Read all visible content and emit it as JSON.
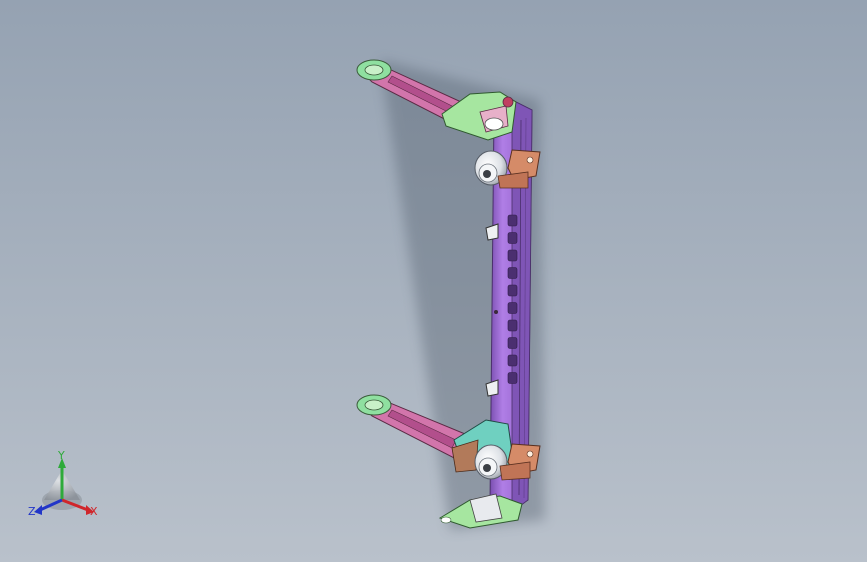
{
  "viewport": {
    "background_top": "#95a2b2",
    "background_bottom": "#b9c1cb"
  },
  "model": {
    "description_icon": "front-subframe-assembly",
    "colors": {
      "crossmember": "#a56fdb",
      "arm": "#cf6fa6",
      "bracket_green": "#a6e6a0",
      "bushing": "#e9ecef",
      "mount_orange": "#d58b68",
      "dark_edge": "#3a2a3a"
    }
  },
  "triad": {
    "x_label": "X",
    "y_label": "Y",
    "z_label": "Z",
    "x_color": "#d0262b",
    "y_color": "#2eaa3a",
    "z_color": "#2236c8"
  }
}
